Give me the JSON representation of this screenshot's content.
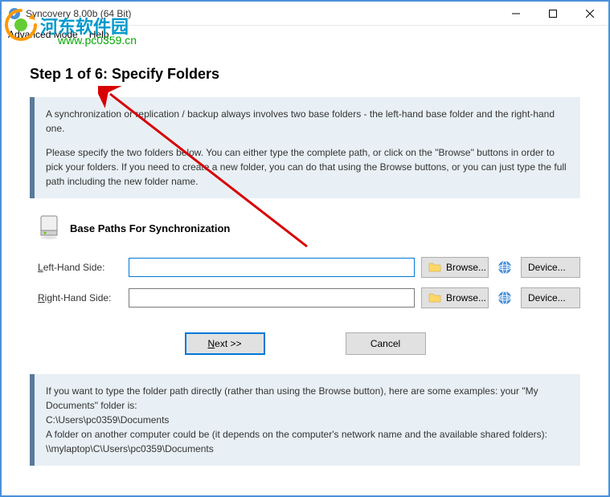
{
  "titlebar": {
    "title": "Syncovery 8.00b (64 Bit)"
  },
  "menubar": {
    "advanced_mode": "Advanced Mode",
    "help": "Help"
  },
  "watermark": {
    "text": "河东软件园",
    "url": "www.pc0359.cn"
  },
  "main": {
    "step_title": "Step 1 of 6: Specify Folders",
    "info_p1": "A synchronization or replication / backup always involves two base folders - the left-hand base folder and the right-hand one.",
    "info_p2": "Please specify the two folders below. You can either type the complete path, or click on the \"Browse\" buttons in order to pick your folders. If you need to create a new folder, you can do that using the Browse buttons, or you can just type the full path including the new folder name.",
    "section_title": "Base Paths For Synchronization",
    "left_label_prefix": "L",
    "left_label_rest": "eft-Hand Side:",
    "right_label_prefix": "R",
    "right_label_rest": "ight-Hand Side:",
    "left_value": "",
    "right_value": "",
    "browse_label": "Browse...",
    "device_label": "Device...",
    "next_prefix": "N",
    "next_rest": "ext >>",
    "cancel_label": "Cancel",
    "help_p1": "If you want to type the folder path directly (rather than using the Browse button), here are some examples: your \"My Documents\" folder is:",
    "help_p2": "C:\\Users\\pc0359\\Documents",
    "help_p3": "A folder on another computer could be (it depends on the computer's network name and the available shared folders): \\\\mylaptop\\C\\Users\\pc0359\\Documents"
  }
}
